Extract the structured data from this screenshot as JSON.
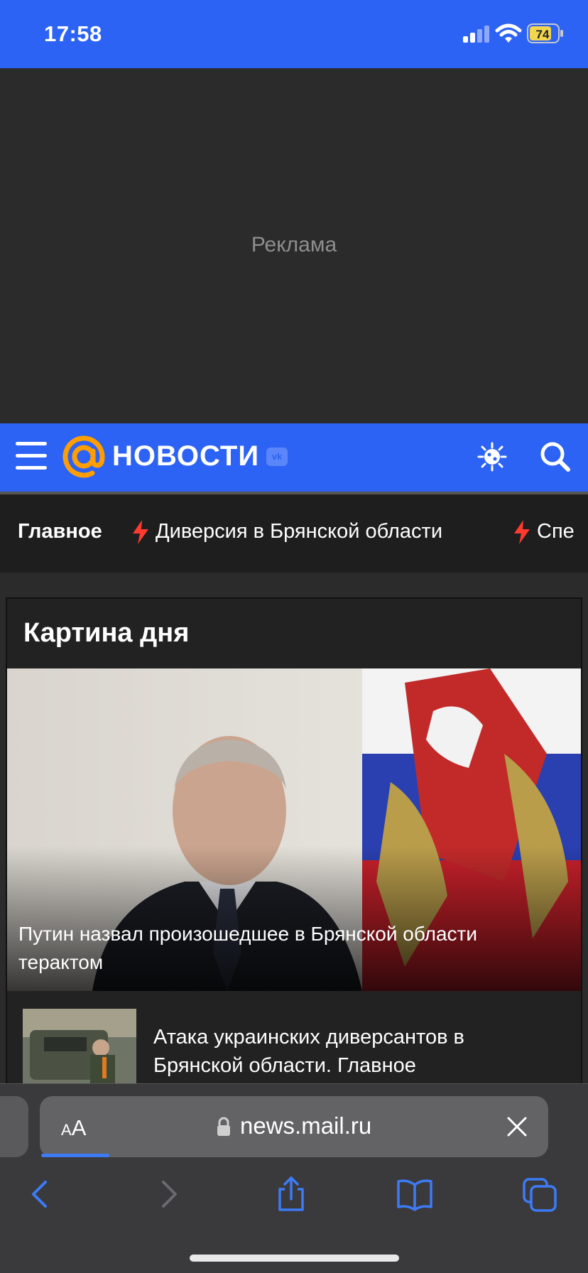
{
  "status_bar": {
    "time": "17:58",
    "battery": "74",
    "accent": "#2d63f5"
  },
  "ad": {
    "label": "Реклама"
  },
  "header": {
    "logo_text": "НОВОСТИ",
    "vk_badge": "vk",
    "icons": [
      "menu-icon",
      "virus-icon",
      "search-icon"
    ]
  },
  "tabs": {
    "main": "Главное",
    "items": [
      "Диверсия в Брянской области",
      "Спе"
    ]
  },
  "card": {
    "title": "Картина дня",
    "hero_caption": "Путин назвал произошедшее в Брянской области терактом",
    "news": [
      {
        "title": "Атака украинских диверсантов в Брянской области. Главное"
      }
    ]
  },
  "browser": {
    "aa_small": "A",
    "aa_big": "A",
    "url": "news.mail.ru",
    "toolbar": [
      "back-icon",
      "forward-icon",
      "share-icon",
      "bookmarks-icon",
      "tabs-icon"
    ]
  }
}
